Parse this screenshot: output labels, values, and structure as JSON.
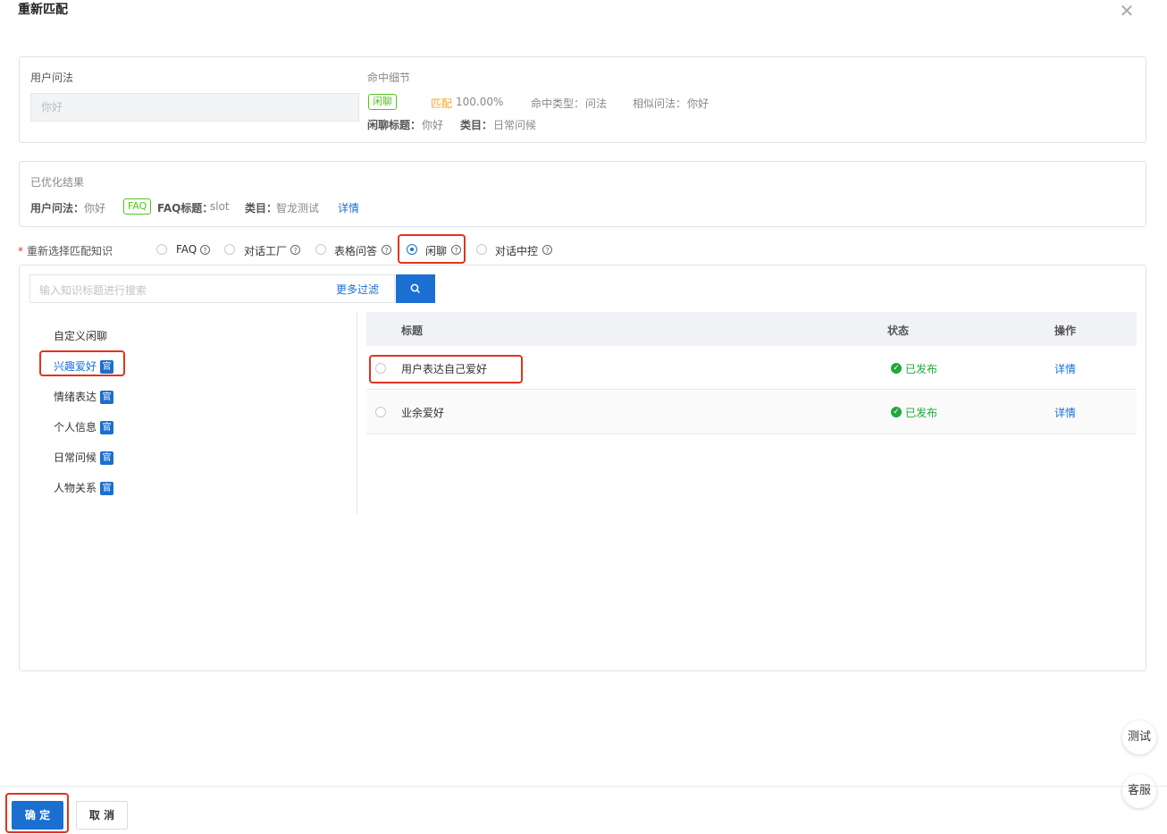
{
  "dialog": {
    "title": "重新匹配",
    "close_icon": "close-icon"
  },
  "user_query": {
    "label": "用户问法",
    "input_value": "你好"
  },
  "hit_detail": {
    "label": "命中细节",
    "tag_type": "闲聊",
    "match_label": "匹配",
    "match_value": "100.00%",
    "hit_type_label": "命中类型：",
    "hit_type_value": "问法",
    "similar_label": "相似问法：",
    "similar_value": "你好",
    "chat_title_label": "闲聊标题：",
    "chat_title_value": "你好",
    "category_label": "类目：",
    "category_value": "日常问候"
  },
  "optimized": {
    "label": "已优化结果",
    "query_label": "用户问法：",
    "query_value": "你好",
    "tag": "FAQ",
    "faq_title_label": "FAQ标题：",
    "faq_title_value": "slot",
    "category_label": "类目：",
    "category_value": "智龙测试",
    "detail_link": "详情"
  },
  "reselect": {
    "required_mark": "*",
    "label": "重新选择匹配知识",
    "options": [
      {
        "label": "FAQ",
        "checked": false
      },
      {
        "label": "对话工厂",
        "checked": false
      },
      {
        "label": "表格问答",
        "checked": false
      },
      {
        "label": "闲聊",
        "checked": true
      },
      {
        "label": "对话中控",
        "checked": false
      }
    ]
  },
  "search": {
    "placeholder": "输入知识标题进行搜索",
    "more_filter": "更多过滤",
    "search_icon": "search-icon"
  },
  "categories": [
    {
      "label": "自定义闲聊",
      "official": ""
    },
    {
      "label": "兴趣爱好",
      "official": "官",
      "active": true
    },
    {
      "label": "情绪表达",
      "official": "官"
    },
    {
      "label": "个人信息",
      "official": "官"
    },
    {
      "label": "日常问候",
      "official": "官"
    },
    {
      "label": "人物关系",
      "official": "官"
    }
  ],
  "table": {
    "headers": {
      "title": "标题",
      "status": "状态",
      "action": "操作"
    },
    "rows": [
      {
        "title": "用户表达自己爱好",
        "status": "已发布",
        "action": "详情"
      },
      {
        "title": "业余爱好",
        "status": "已发布",
        "action": "详情"
      }
    ]
  },
  "footer": {
    "confirm": "确 定",
    "cancel": "取 消"
  },
  "floating": {
    "test": "测试",
    "service": "客服"
  },
  "colors": {
    "primary": "#1a6fd1",
    "success": "#1fa83b",
    "highlight": "#e0341f"
  }
}
